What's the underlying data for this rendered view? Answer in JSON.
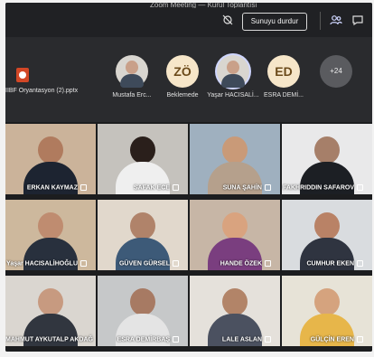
{
  "topbar": {
    "title": "Zoom Meeting — Kurul Toplantısı",
    "stop_share_label": "Sunuyu durdur"
  },
  "strip": {
    "file_name": "IIBF Oryantasyon (2).pptx",
    "attendees": [
      {
        "name": "Mustafa Erc...",
        "type": "photo"
      },
      {
        "name": "Beklemede",
        "initials": "ZÖ",
        "type": "initials"
      },
      {
        "name": "Yaşar HACISALİ...",
        "type": "photo",
        "selected": true
      },
      {
        "name": "ESRA DEMİ...",
        "initials": "ED",
        "type": "initials"
      },
      {
        "name": "",
        "count": "+24",
        "type": "count"
      }
    ]
  },
  "gallery": [
    {
      "name": "ERKAN KAYMAZ"
    },
    {
      "name": "SAFAK ECE"
    },
    {
      "name": "SUNA ŞAHİN"
    },
    {
      "name": "FAKHRIDDIN SAFAROV"
    },
    {
      "name": "Yaşar HACISALİHOĞLU"
    },
    {
      "name": "GÜVEN GÜRSEL"
    },
    {
      "name": "HANDE ÖZEK"
    },
    {
      "name": "CUMHUR EKEN"
    },
    {
      "name": "MAHMUT AYKUTALP AKDAĞ"
    },
    {
      "name": "ESRA DEMİRBAŞ"
    },
    {
      "name": "LALE ASLAN"
    },
    {
      "name": "GÜLÇİN EREN"
    }
  ],
  "colors": {
    "accent": "#cfd6ff",
    "presenter_bar": "#202124"
  }
}
